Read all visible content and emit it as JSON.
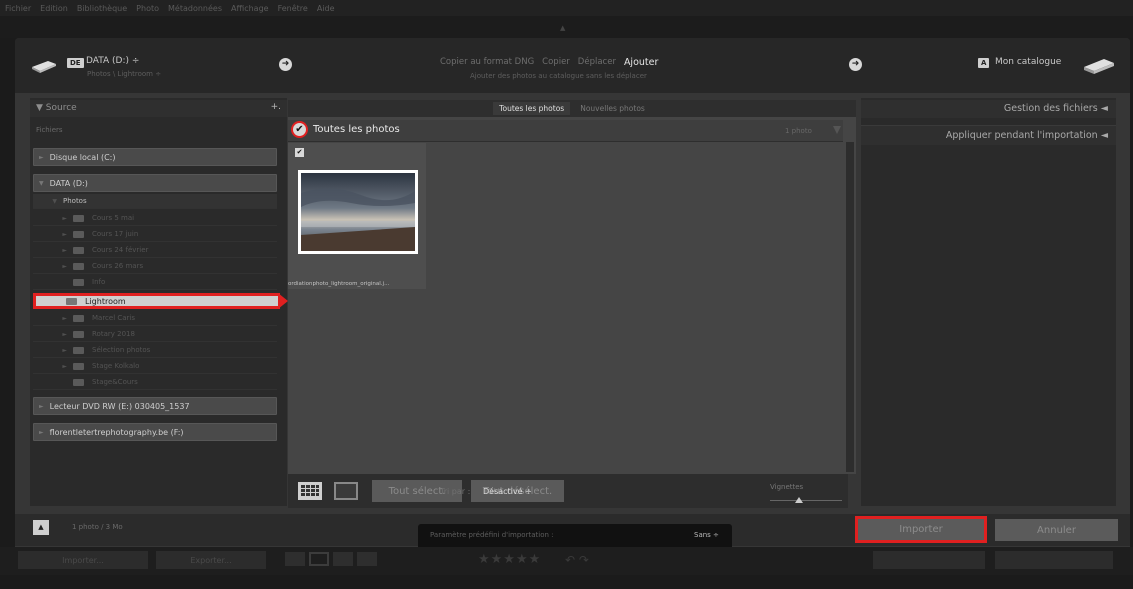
{
  "menu": [
    "Fichier",
    "Edition",
    "Bibliothèque",
    "Photo",
    "Métadonnées",
    "Affichage",
    "Fenêtre",
    "Aide"
  ],
  "header": {
    "source_badge": "DE",
    "source_name": "DATA (D:) ÷",
    "source_path": "Photos \\ Lightroom ÷",
    "arrow_left": "➜",
    "modes": [
      "Copier au format DNG",
      "Copier",
      "Déplacer"
    ],
    "mode_active": "Ajouter",
    "mode_description": "Ajouter des photos au catalogue sans les déplacer",
    "arrow_right": "➜",
    "dest_badge": "A",
    "dest_name": "Mon catalogue"
  },
  "source_panel": {
    "title": "▼ Source",
    "add": "+.",
    "section": "Fichiers",
    "drives": [
      {
        "label": "Disque local (C:)"
      },
      {
        "label": "DATA (D:)"
      }
    ],
    "photos_label": "Photos",
    "folders_top": [
      "Cours 5 mai",
      "Cours 17 juin",
      "Cours 24 février",
      "Cours 26 mars",
      "Info"
    ],
    "selected_folder": "Lightroom",
    "folders_bottom": [
      "Marcel Caris",
      "Rotary 2018",
      "Sélection photos",
      "Stage Kolkalo",
      "Stage&Cours"
    ],
    "drives_bottom": [
      {
        "label": "Lecteur DVD RW (E:) 030405_1537"
      },
      {
        "label": "florentletertrephotography.be (F:)"
      }
    ]
  },
  "center": {
    "tab_all": "Toutes les photos",
    "tab_new": "Nouvelles photos",
    "group_check": "✔",
    "group_title": "Toutes les photos",
    "photo_count": "1 photo",
    "thumb_check": "✔",
    "thumb_filename": "ordiationphoto_lightroom_original.j...",
    "btn_select_all": "Tout sélect.",
    "btn_deselect_all": "Tout désélect.",
    "sort_label": "Tri par :",
    "sort_value": "Désactivé ÷",
    "thumbs_label": "Vignettes"
  },
  "right_panel": {
    "file_handling": "Gestion des fichiers ◄",
    "apply_import": "Appliquer pendant l'importation ◄"
  },
  "footer": {
    "up": "▲",
    "size": "1 photo / 3 Mo",
    "preset_label": "Paramètre prédéfini d'importation :",
    "preset_value": "Sans ÷",
    "import": "Importer",
    "cancel": "Annuler"
  },
  "bottom_strip": {
    "import": "Importer...",
    "export": "Exporter...",
    "stars": "★★★★★"
  },
  "colors": {
    "highlight": "#e02020",
    "dialog": "#363636"
  }
}
